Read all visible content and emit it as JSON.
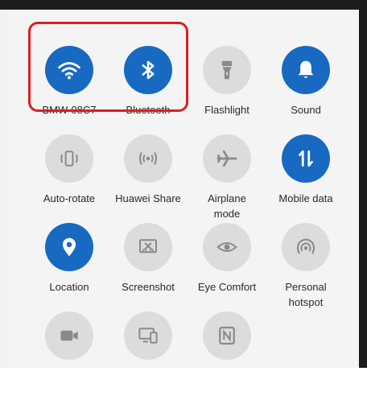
{
  "tiles": [
    {
      "label": "BMW-08C7",
      "icon": "wifi-icon",
      "active": true
    },
    {
      "label": "Bluetooth",
      "icon": "bluetooth-icon",
      "active": true
    },
    {
      "label": "Flashlight",
      "icon": "flashlight-icon",
      "active": false
    },
    {
      "label": "Sound",
      "icon": "bell-icon",
      "active": true
    },
    {
      "label": "Auto-rotate",
      "icon": "auto-rotate-icon",
      "active": false
    },
    {
      "label": "Huawei Share",
      "icon": "huawei-share-icon",
      "active": false
    },
    {
      "label": "Airplane\nmode",
      "icon": "airplane-icon",
      "active": false
    },
    {
      "label": "Mobile data",
      "icon": "mobile-data-icon",
      "active": true
    },
    {
      "label": "Location",
      "icon": "location-pin-icon",
      "active": true
    },
    {
      "label": "Screenshot",
      "icon": "screenshot-icon",
      "active": false
    },
    {
      "label": "Eye Comfort",
      "icon": "eye-icon",
      "active": false
    },
    {
      "label": "Personal\nhotspot",
      "icon": "hotspot-icon",
      "active": false
    },
    {
      "label": "",
      "icon": "screen-recorder-icon",
      "active": false
    },
    {
      "label": "",
      "icon": "wireless-projection-icon",
      "active": false
    },
    {
      "label": "",
      "icon": "nfc-icon",
      "active": false
    }
  ],
  "colors": {
    "active": "#1769c2",
    "inactive": "#dcdcdc",
    "inactive_glyph": "#8a8a8a",
    "highlight": "#dc1f1f"
  }
}
